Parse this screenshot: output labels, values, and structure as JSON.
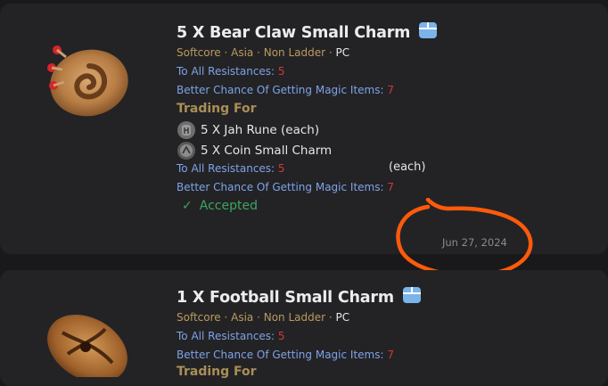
{
  "listings": [
    {
      "title": "5 X Bear Claw Small Charm",
      "meta": {
        "mode": "Softcore",
        "sep1": " · ",
        "region": "Asia",
        "sep2": " · ",
        "ladder": "Non Ladder",
        "sep3": " · ",
        "platform": "PC"
      },
      "props": [
        {
          "label": "To All Resistances: ",
          "value": "5"
        },
        {
          "label": "Better Chance Of Getting Magic Items: ",
          "value": "7"
        }
      ],
      "trading_for_label": "Trading For",
      "trade_items": [
        {
          "text": "5 X Jah Rune (each)",
          "icon": "jah-rune-icon"
        },
        {
          "text": "5 X Coin Small Charm",
          "icon": "coin-charm-icon"
        }
      ],
      "trade_props": [
        {
          "label": "To All Resistances: ",
          "value": "5"
        },
        {
          "label": "Better Chance Of Getting Magic Items: ",
          "value": "7"
        }
      ],
      "each_label": "(each)",
      "status": "Accepted",
      "date": "Jun 27, 2024"
    },
    {
      "title": "1 X Football Small Charm",
      "meta": {
        "mode": "Softcore",
        "sep1": " · ",
        "region": "Asia",
        "sep2": " · ",
        "ladder": "Non Ladder",
        "sep3": " · ",
        "platform": "PC"
      },
      "props": [
        {
          "label": "To All Resistances: ",
          "value": "5"
        },
        {
          "label": "Better Chance Of Getting Magic Items: ",
          "value": "7"
        }
      ],
      "trading_for_label": "Trading For"
    }
  ],
  "colors": {
    "accent_title": "#ececec",
    "meta_gold": "#b99a5c",
    "prop_blue": "#7fa2e6",
    "prop_value_red": "#d13a32",
    "status_green": "#3ea65c",
    "annotation_orange": "#ff5a0a"
  }
}
